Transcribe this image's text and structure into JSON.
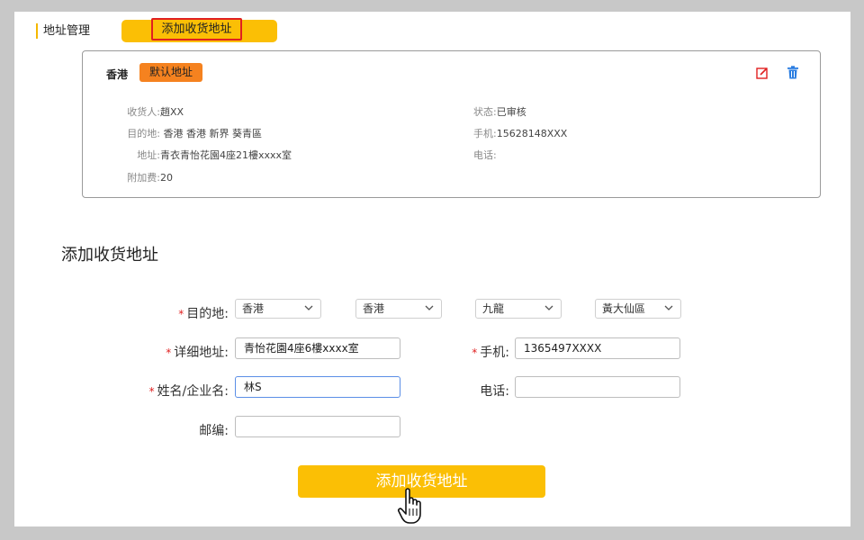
{
  "header": {
    "title": "地址管理",
    "add_tab_label": "添加收货地址"
  },
  "address_card": {
    "region": "香港",
    "default_badge": "默认地址",
    "rows_left": [
      {
        "label": "收货人:",
        "value": "趙XX"
      },
      {
        "label": "目的地:",
        "value": " 香港 香港 新界 葵青區"
      },
      {
        "label": "地址:",
        "value": "青衣青怡花園4座21樓xxxx室"
      },
      {
        "label": "附加费:",
        "value": "20"
      }
    ],
    "rows_right": [
      {
        "label": "状态:",
        "value": "已审核"
      },
      {
        "label": "手机:",
        "value": "15628148XXX"
      },
      {
        "label": "电话:",
        "value": ""
      }
    ],
    "icons": {
      "edit": "edit-icon",
      "delete": "trash-icon"
    },
    "colors": {
      "edit": "#e02020",
      "delete": "#2a7de1"
    }
  },
  "form": {
    "title": "添加收货地址",
    "destination_label": "目的地:",
    "destination_selects": [
      "香港",
      "香港",
      "九龍",
      "黃大仙區"
    ],
    "detail_label": "详细地址:",
    "detail_value": "青怡花園4座6樓xxxx室",
    "mobile_label": "手机:",
    "mobile_value": "1365497XXXX",
    "name_label": "姓名/企业名:",
    "name_value": "林S",
    "phone_label": "电话:",
    "phone_value": "",
    "zip_label": "邮编:",
    "zip_value": "",
    "required_mark": "*",
    "submit_label": "添加收货地址"
  },
  "colors": {
    "accent": "#fbbf05",
    "badge": "#f5821f",
    "required": "#e02020",
    "focus_border": "#5b8ee6"
  }
}
